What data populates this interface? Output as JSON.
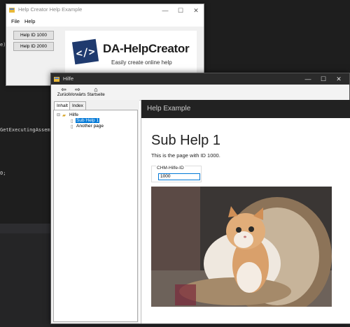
{
  "ide": {
    "code_lines": [
      "e)",
      "GetExecutingAssembly(",
      "0;"
    ]
  },
  "help_creator": {
    "title": "Help Creator Help Example",
    "menu": [
      "File",
      "Help"
    ],
    "buttons": [
      "Help ID 1000",
      "Help ID 2000"
    ],
    "logo_text": "DA-HelpCreator",
    "logo_tagline": "Easily create online help",
    "window_controls": [
      "—",
      "☐",
      "✕"
    ]
  },
  "hilfe": {
    "title": "Hilfe",
    "window_controls": [
      "—",
      "☐",
      "✕"
    ],
    "toolbar": [
      {
        "label": "Zurück",
        "icon": "back-arrow-icon"
      },
      {
        "label": "Vorwärts",
        "icon": "forward-arrow-icon"
      },
      {
        "label": "Startseite",
        "icon": "home-icon"
      }
    ],
    "tabs": [
      "Inhalt",
      "Index"
    ],
    "tree": {
      "root": "Hilfe",
      "children": [
        "Sub Help 1",
        "Another page"
      ],
      "selected": "Sub Help 1"
    },
    "content": {
      "header": "Help Example",
      "title": "Sub Help 1",
      "description": "This is the page with ID 1000.",
      "field_label": "CHM-Hilfe-ID",
      "field_value": "1000"
    }
  },
  "colors": {
    "accent": "#0078d7",
    "logo_blue": "#1f3a6e",
    "header_dark": "#222222"
  }
}
